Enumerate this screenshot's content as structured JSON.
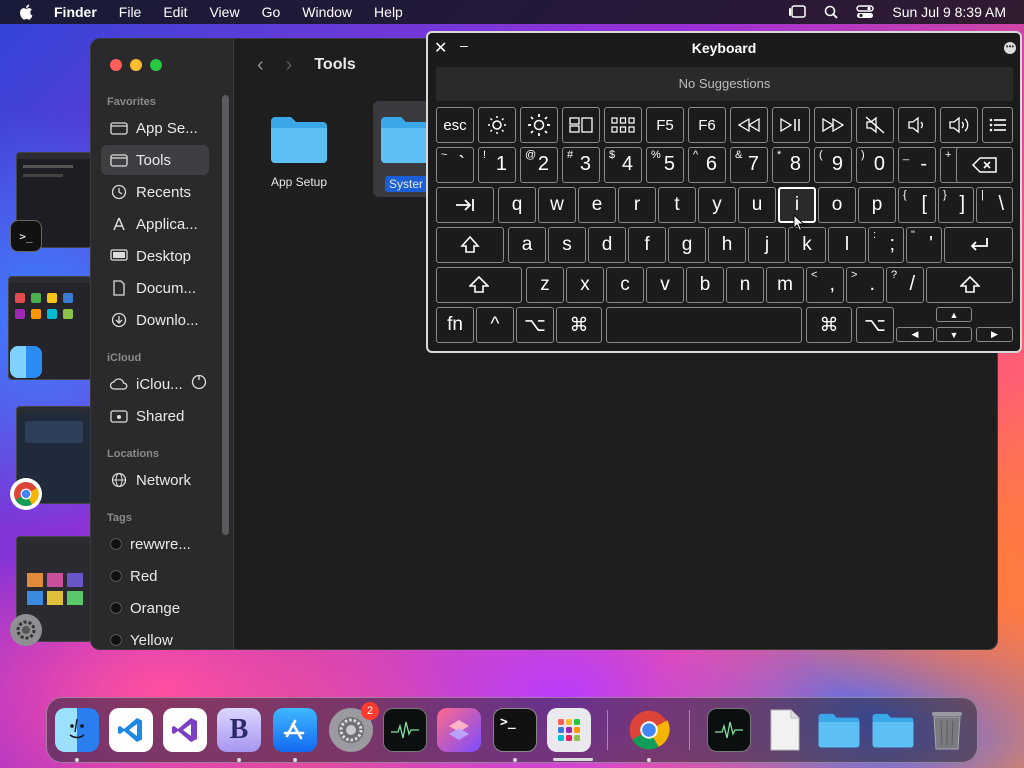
{
  "menubar": {
    "app": "Finder",
    "items": [
      "File",
      "Edit",
      "View",
      "Go",
      "Window",
      "Help"
    ],
    "clock": "Sun Jul 9  8:39 AM"
  },
  "finder": {
    "title": "Tools",
    "sections": {
      "favorites": "Favorites",
      "icloud": "iCloud",
      "locations": "Locations",
      "tags": "Tags"
    },
    "favorites": [
      "App Se...",
      "Tools",
      "Recents",
      "Applica...",
      "Desktop",
      "Docum...",
      "Downlo..."
    ],
    "icloud": [
      "iClou...",
      "Shared"
    ],
    "locations": [
      "Network"
    ],
    "tags": [
      "rewwre...",
      "Red",
      "Orange",
      "Yellow"
    ],
    "items": [
      "App Setup",
      "Syster"
    ]
  },
  "keyboard": {
    "title": "Keyboard",
    "suggestions": "No Suggestions",
    "row_fn": [
      "esc",
      "F5",
      "F6"
    ],
    "row_num": [
      {
        "sup": "~",
        "main": "`"
      },
      {
        "sup": "!",
        "main": "1"
      },
      {
        "sup": "@",
        "main": "2"
      },
      {
        "sup": "#",
        "main": "3"
      },
      {
        "sup": "$",
        "main": "4"
      },
      {
        "sup": "%",
        "main": "5"
      },
      {
        "sup": "^",
        "main": "6"
      },
      {
        "sup": "&",
        "main": "7"
      },
      {
        "sup": "*",
        "main": "8"
      },
      {
        "sup": "(",
        "main": "9"
      },
      {
        "sup": ")",
        "main": "0"
      },
      {
        "sup": "_",
        "main": "-"
      },
      {
        "sup": "+",
        "main": "="
      }
    ],
    "row_q": [
      "q",
      "w",
      "e",
      "r",
      "t",
      "y",
      "u",
      "i",
      "o",
      "p"
    ],
    "row_q_extra": [
      {
        "sup": "{",
        "main": "["
      },
      {
        "sup": "}",
        "main": "]"
      },
      {
        "sup": "|",
        "main": "\\"
      }
    ],
    "row_a": [
      "a",
      "s",
      "d",
      "f",
      "g",
      "h",
      "j",
      "k",
      "l"
    ],
    "row_a_extra": [
      {
        "sup": ":",
        "main": ";"
      },
      {
        "sup": "\"",
        "main": "'"
      }
    ],
    "row_z": [
      "z",
      "x",
      "c",
      "v",
      "b",
      "n",
      "m"
    ],
    "row_z_extra": [
      {
        "sup": "<",
        "main": ","
      },
      {
        "sup": ">",
        "main": "."
      },
      {
        "sup": "?",
        "main": "/"
      }
    ],
    "row_bottom": {
      "fn": "fn",
      "ctrl": "^",
      "opt": "⌥",
      "cmd": "⌘"
    },
    "highlighted_key": "i"
  },
  "dock": {
    "settings_badge": "2",
    "icons": [
      "finder-icon",
      "vscode-icon",
      "visual-studio-icon",
      "bbedit-icon",
      "app-store-icon",
      "system-settings-icon",
      "activity-monitor-icon",
      "shortcuts-icon",
      "terminal-icon",
      "launchpad-icon",
      "chrome-icon",
      "activity-monitor-2-icon",
      "document-icon",
      "folder-icon",
      "downloads-folder-icon",
      "trash-icon"
    ]
  }
}
